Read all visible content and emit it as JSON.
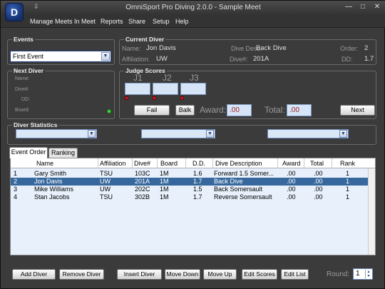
{
  "window": {
    "title": "OmniSport Pro Diving 2.0.0 - Sample Meet",
    "logo_text": "D",
    "sysmenu": "⇩",
    "minimize": "—",
    "maximize": "□",
    "close": "✕"
  },
  "menu": [
    "Manage Meets",
    "In Meet",
    "Reports",
    "Share",
    "Setup",
    "Help"
  ],
  "events": {
    "title": "Events",
    "selected": "First Event",
    "arrow": "▼"
  },
  "current_diver": {
    "title": "Current Diver",
    "name_label": "Name:",
    "name": "Jon Davis",
    "affiliation_label": "Affiliation:",
    "affiliation": "UW",
    "dive_desc_label": "Dive Desc:",
    "dive_desc": "Back Dive",
    "dive_num_label": "Dive#:",
    "dive_num": "201A",
    "order_label": "Order:",
    "order": "2",
    "dd_label": "DD:",
    "dd": "1.7"
  },
  "next_diver": {
    "title": "Next Diver",
    "name_label": "Name:",
    "dive_label": "Dive#:",
    "dd_label": "DD:",
    "board_label": "Board:",
    "status_color": "#37e037"
  },
  "judge_scores": {
    "title": "Judge Scores",
    "judges": [
      "J1",
      "J2",
      "J3"
    ],
    "fail_label": "Fail",
    "balk_label": "Balk",
    "award_label": "Award:",
    "award_value": ".00",
    "total_label": "Total:",
    "total_value": ".00",
    "next_label": "Next"
  },
  "diver_statistics": {
    "title": "Diver Statistics",
    "arrow": "▼"
  },
  "tabs": [
    {
      "label": "Event Order",
      "active": true
    },
    {
      "label": "Ranking",
      "active": false
    }
  ],
  "table": {
    "columns": [
      "Name",
      "Affiliation",
      "Dive#",
      "Board",
      "D.D.",
      "Dive Description",
      "Award",
      "Total",
      "Rank"
    ],
    "rows": [
      {
        "order": "1",
        "name": "Gary Smith",
        "affiliation": "TSU",
        "dive": "103C",
        "board": "1M",
        "dd": "1.6",
        "desc": "Forward 1.5 Somer...",
        "award": ".00",
        "total": ".00",
        "rank": "1",
        "selected": false
      },
      {
        "order": "2",
        "name": "Jon Davis",
        "affiliation": "UW",
        "dive": "201A",
        "board": "1M",
        "dd": "1.7",
        "desc": "Back Dive",
        "award": ".00",
        "total": ".00",
        "rank": "1",
        "selected": true
      },
      {
        "order": "3",
        "name": "Mike Williams",
        "affiliation": "UW",
        "dive": "202C",
        "board": "1M",
        "dd": "1.5",
        "desc": "Back Somersault",
        "award": ".00",
        "total": ".00",
        "rank": "1",
        "selected": false
      },
      {
        "order": "4",
        "name": "Stan Jacobs",
        "affiliation": "TSU",
        "dive": "302B",
        "board": "1M",
        "dd": "1.7",
        "desc": "Reverse Somersault",
        "award": ".00",
        "total": ".00",
        "rank": "1",
        "selected": false
      }
    ]
  },
  "buttons": {
    "add_diver": "Add Diver",
    "remove_diver": "Remove Diver",
    "insert_diver": "Insert Diver",
    "move_down": "Move Down",
    "move_up": "Move Up",
    "edit_scores": "Edit Scores",
    "edit_list": "Edit List"
  },
  "round": {
    "label": "Round:",
    "value": "1",
    "up": "▲",
    "down": "▼"
  },
  "colors": {
    "selection": "#37689d",
    "score_text": "#9a2020",
    "judge_marker": "#c22222",
    "status_led": "#37e037"
  }
}
